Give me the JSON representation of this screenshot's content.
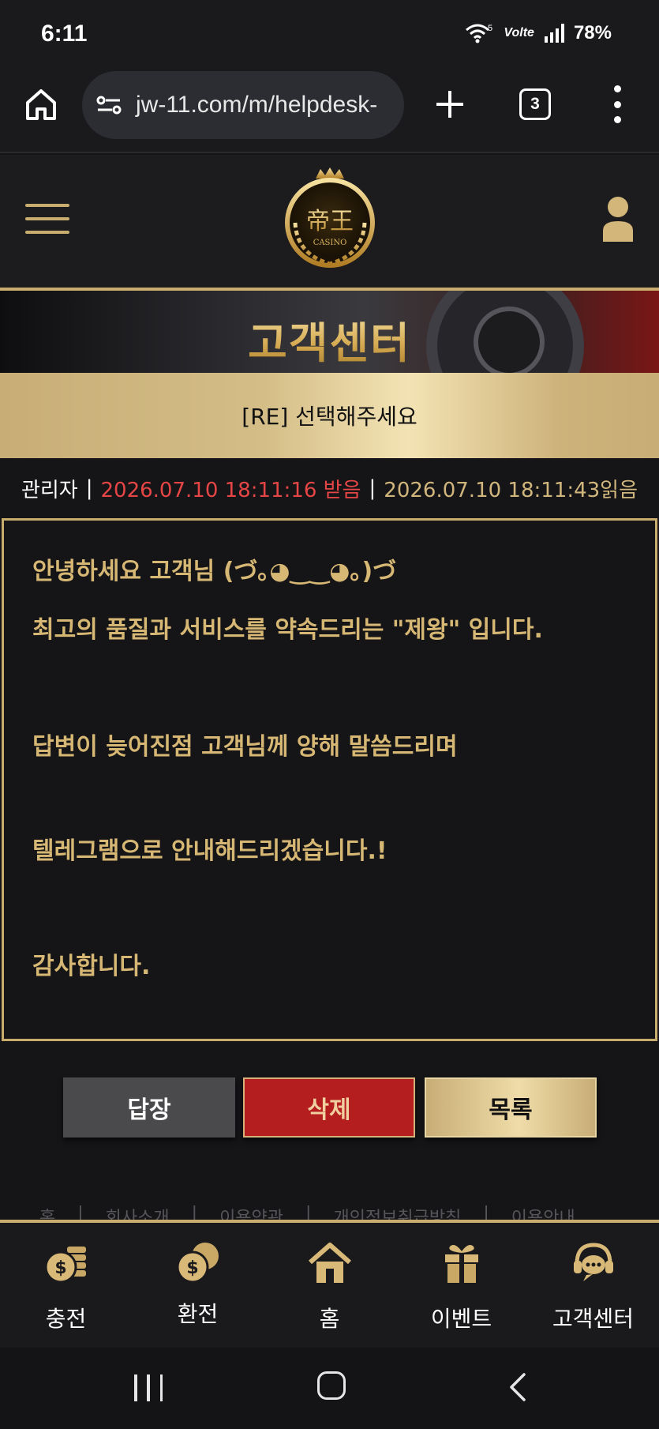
{
  "status_bar": {
    "time": "6:11",
    "battery": "78%",
    "network": "Volte",
    "wifi_badge": "5"
  },
  "browser": {
    "url": "jw-11.com/m/helpdesk-",
    "tab_count": "3"
  },
  "site": {
    "logo_text": "帝王",
    "logo_sub": "CASINO",
    "banner_title": "고객센터"
  },
  "post": {
    "subject": "[RE] 선택해주세요",
    "author": "관리자",
    "received": "2026.07.10 18:11:16 받음",
    "read": "2026.07.10 18:11:43읽음",
    "separator": "|",
    "lines": [
      "안녕하세요 고객님 (づ｡◕‿‿◕｡)づ",
      "최고의 품질과 서비스를 약속드리는 \"제왕\" 입니다.",
      "답변이 늦어진점 고객님께 양해 말씀드리며",
      "텔레그램으로 안내해드리겠습니다.!",
      "감사합니다."
    ]
  },
  "actions": {
    "reply": "답장",
    "delete": "삭제",
    "list": "목록"
  },
  "footer_links": [
    "홈",
    "|",
    "회사소개",
    "|",
    "이용약관",
    "|",
    "개인정보취급방침",
    "|",
    "이용안내"
  ],
  "bottom_nav": [
    {
      "label": "충전",
      "icon": "deposit-coins-icon"
    },
    {
      "label": "환전",
      "icon": "exchange-coins-icon"
    },
    {
      "label": "홈",
      "icon": "home-icon"
    },
    {
      "label": "이벤트",
      "icon": "gift-icon"
    },
    {
      "label": "고객센터",
      "icon": "support-headset-icon"
    }
  ],
  "colors": {
    "gold": "#c8ad6e",
    "received_red": "#e64545",
    "delete_red": "#b51e1e",
    "background": "#151518"
  }
}
